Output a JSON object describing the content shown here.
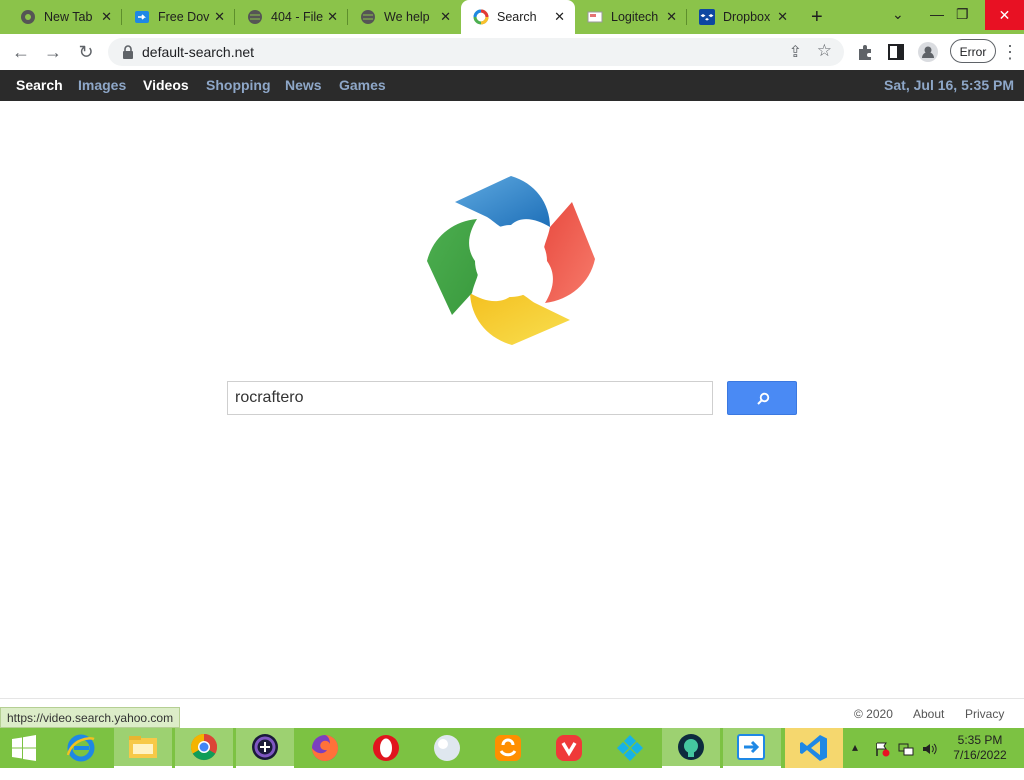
{
  "browser": {
    "tabs": [
      {
        "title": "New Tab",
        "icon": "chrome-icon"
      },
      {
        "title": "Free Dov",
        "icon": "download-icon"
      },
      {
        "title": "404 - File",
        "icon": "globe-icon"
      },
      {
        "title": "We help",
        "icon": "globe-icon"
      },
      {
        "title": "Search",
        "icon": "search-logo-icon",
        "active": true
      },
      {
        "title": "Logitech",
        "icon": "logitech-icon"
      },
      {
        "title": "Dropbox",
        "icon": "dropbox-icon"
      }
    ],
    "new_tab": "+",
    "url": "default-search.net",
    "profile_button": "Error"
  },
  "site_nav": {
    "items": [
      {
        "label": "Search",
        "active": true
      },
      {
        "label": "Images",
        "active": false
      },
      {
        "label": "Videos",
        "active": true
      },
      {
        "label": "Shopping",
        "active": false
      },
      {
        "label": "News",
        "active": false
      },
      {
        "label": "Games",
        "active": false
      }
    ],
    "datetime": "Sat, Jul 16, 5:35 PM"
  },
  "search": {
    "query": "rocraftero"
  },
  "footer": {
    "copyright": "© 2020",
    "about": "About",
    "privacy": "Privacy"
  },
  "status_url": "https://video.search.yahoo.com",
  "taskbar": {
    "apps": [
      "start-icon",
      "ie-icon",
      "file-explorer-icon",
      "chrome-icon",
      "app-icon",
      "firefox-icon",
      "opera-icon",
      "ball-icon",
      "uc-browser-icon",
      "vivaldi-icon",
      "kodi-icon",
      "github-icon",
      "download-manager-icon",
      "vscode-icon"
    ],
    "time": "5:35 PM",
    "date": "7/16/2022"
  },
  "colors": {
    "tabstrip": "#8bc34a",
    "taskbar": "#7cc242",
    "search_button": "#4a8af4",
    "nav_bg": "#2b2b2b"
  }
}
